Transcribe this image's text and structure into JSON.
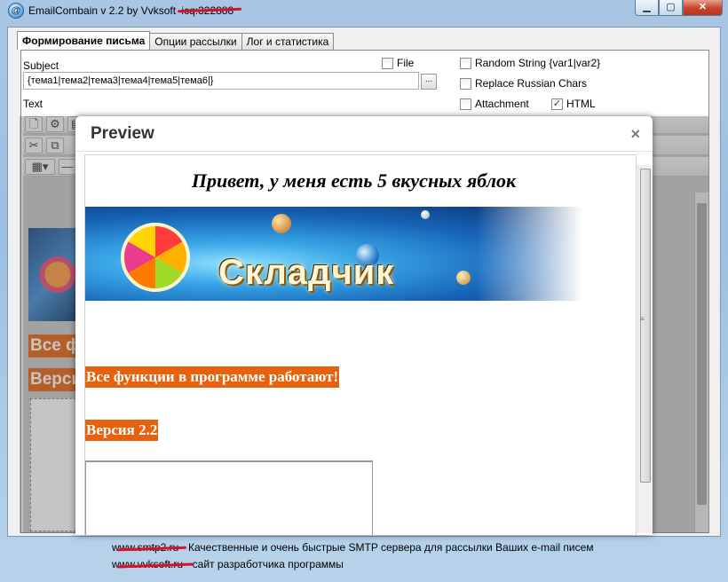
{
  "window": {
    "title": "EmailCombain v 2.2 by Vvksoft",
    "title_redacted": "icq:322888",
    "min_glyph": "▁",
    "max_glyph": "▢",
    "close_glyph": "✕",
    "app_icon_glyph": "@"
  },
  "tabs": [
    {
      "label": "Формирование письма",
      "active": true
    },
    {
      "label": "Опции рассылки",
      "active": false
    },
    {
      "label": "Лог и статистика",
      "active": false
    }
  ],
  "form": {
    "subject_label": "Subject",
    "subject_value": "{тема1|тема2|тема3|тема4|тема5|тема6|}",
    "browse_label": "...",
    "text_label": "Text",
    "file_label": "File",
    "random_string_label": "Random String {var1|var2}",
    "replace_russian_label": "Replace Russian Chars",
    "attachment_label": "Attachment",
    "html_label": "HTML",
    "html_checked": true,
    "file_checked": false,
    "random_checked": false,
    "replace_checked": false,
    "attachment_checked": false
  },
  "editor": {
    "line1_partial": "Все ф",
    "line2_partial": "Верси"
  },
  "preview": {
    "title": "Preview",
    "close_glyph": "×",
    "heading": "Привет, у меня есть 5 вкусных яблок",
    "banner_text": "Складчик",
    "line1": "Все функции в программе работают!",
    "line2": "Версия 2.2"
  },
  "status": {
    "line1_site": "www.smtp2.ru",
    "line1_text": " - Качественные и очень быстрые SMTP сервера для рассылки Ваших e-mail писем",
    "line2_site": "www.vvksoft.ru",
    "line2_text": " - сайт разработчика программы"
  },
  "colors": {
    "accent_orange": "#e8620e",
    "redact_red": "#d8102a"
  }
}
